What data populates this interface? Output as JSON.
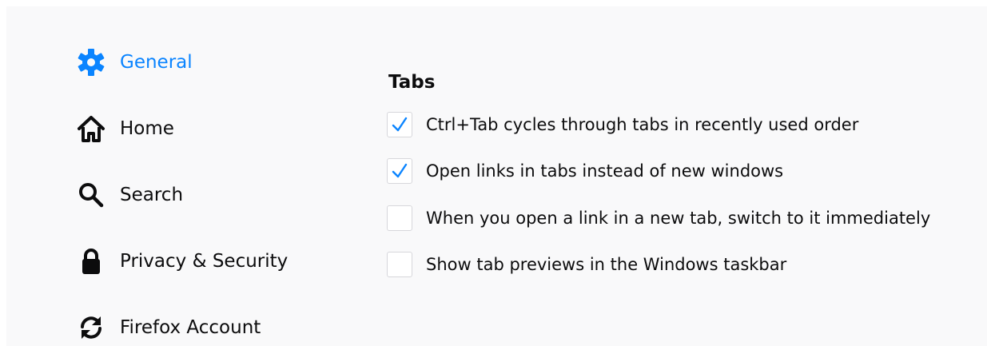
{
  "sidebar": {
    "items": [
      {
        "label": "General",
        "icon": "gear-icon",
        "selected": true
      },
      {
        "label": "Home",
        "icon": "home-icon",
        "selected": false
      },
      {
        "label": "Search",
        "icon": "search-icon",
        "selected": false
      },
      {
        "label": "Privacy & Security",
        "icon": "lock-icon",
        "selected": false
      },
      {
        "label": "Firefox Account",
        "icon": "sync-icon",
        "selected": false
      }
    ]
  },
  "tabs_section": {
    "title": "Tabs",
    "options": [
      {
        "label": "Ctrl+Tab cycles through tabs in recently used order",
        "checked": true
      },
      {
        "label": "Open links in tabs instead of new windows",
        "checked": true
      },
      {
        "label": "When you open a link in a new tab, switch to it immediately",
        "checked": false
      },
      {
        "label": "Show tab previews in the Windows taskbar",
        "checked": false
      }
    ]
  },
  "colors": {
    "accent": "#0a84ff",
    "text": "#0c0c0d",
    "background": "#f9f9fa",
    "checkbox_border": "#d7d7db"
  }
}
